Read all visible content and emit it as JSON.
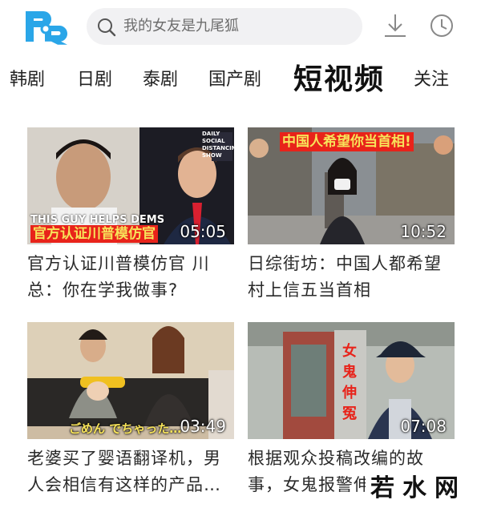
{
  "header": {
    "search_placeholder": "我的女友是九尾狐",
    "icons": [
      "logo",
      "search-icon",
      "download-icon",
      "history-clock-icon"
    ]
  },
  "tabs": [
    {
      "label": "韩剧"
    },
    {
      "label": "日剧"
    },
    {
      "label": "泰剧"
    },
    {
      "label": "国产剧"
    },
    {
      "label": "短视频",
      "active": true
    },
    {
      "label": "关注"
    }
  ],
  "videos": [
    {
      "title": "官方认证川普模仿官 川总：你在学我做事?",
      "duration": "05:05",
      "overlay_caption": "官方认证川普模仿官",
      "overlay_english": "THIS GUY HELPS DEMS",
      "show_logo": "DAILY SOCIAL DISTANCING SHOW"
    },
    {
      "title": "日综街坊：中国人都希望村上信五当首相",
      "duration": "10:52",
      "overlay_caption": "中国人希望你当首相!"
    },
    {
      "title": "老婆买了婴语翻译机，男人会相信有这样的产品…",
      "duration": "03:49",
      "overlay_caption": "ごめん でちゃった…"
    },
    {
      "title": "根据观众投稿改编的故事，女鬼报警伸",
      "duration": "07:08",
      "overlay_caption": "女鬼伸冤"
    }
  ],
  "watermark": "若水网",
  "colors": {
    "logo_blue": "#2aa6e8",
    "caption_red": "#e8231a",
    "caption_yellow": "#f7e35a"
  }
}
